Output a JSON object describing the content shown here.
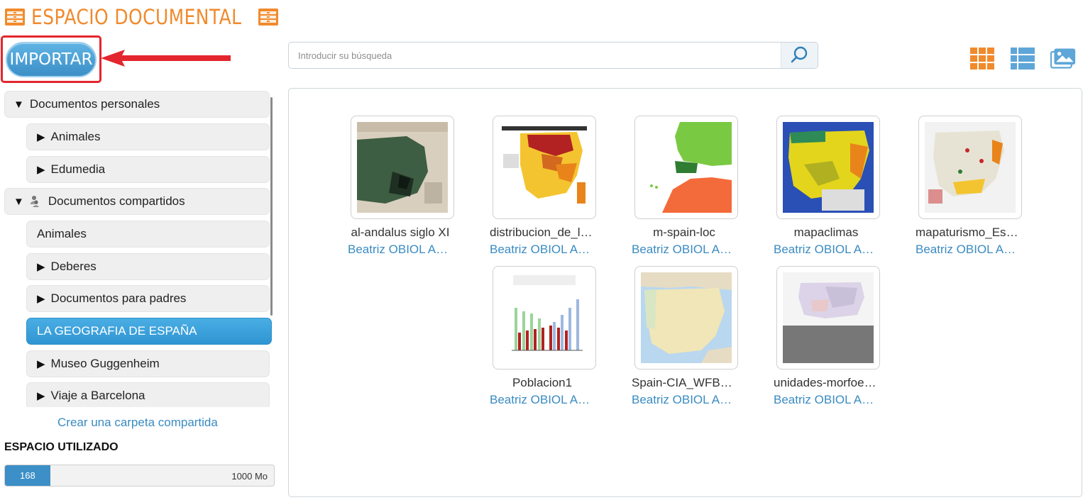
{
  "app": {
    "title": "ESPACIO DOCUMENTAL",
    "brand_color": "#f18a2c",
    "accent_color": "#3c8fc7"
  },
  "toolbar": {
    "import_label": "IMPORTAR",
    "search_placeholder": "Introducir su búsqueda",
    "search_icon": "search-icon",
    "view_icons": [
      "grid-view-icon",
      "list-view-icon",
      "gallery-view-icon"
    ]
  },
  "sidebar": {
    "personal": {
      "label": "Documentos personales",
      "expanded": true
    },
    "personal_items": [
      {
        "label": "Animales",
        "collapsed": true
      },
      {
        "label": "Edumedia",
        "collapsed": true
      }
    ],
    "shared": {
      "label": "Documentos compartidos",
      "expanded": true
    },
    "shared_items": [
      {
        "label": "Animales",
        "has_children": false
      },
      {
        "label": "Deberes",
        "has_children": true
      },
      {
        "label": "Documentos para padres",
        "has_children": true
      },
      {
        "label": "LA GEOGRAFIA DE ESPAÑA",
        "has_children": false,
        "selected": true
      },
      {
        "label": "Museo Guggenheim",
        "has_children": true
      },
      {
        "label": "Viaje a Barcelona",
        "has_children": true
      }
    ],
    "create_link": "Crear una carpeta compartida",
    "space": {
      "title": "ESPACIO UTILIZADO",
      "used": "168",
      "total": "1000 Mo",
      "used_fraction": 0.168
    }
  },
  "files": [
    {
      "name": "al-andalus siglo XI",
      "owner": "Beatriz OBIOL ALONSO",
      "thumb": "historical-map"
    },
    {
      "name": "distribucion_de_la_poblacion",
      "owner": "Beatriz OBIOL ALONSO",
      "thumb": "population-map"
    },
    {
      "name": "m-spain-loc",
      "owner": "Beatriz OBIOL ALONSO",
      "thumb": "location-map"
    },
    {
      "name": "mapaclimas",
      "owner": "Beatriz OBIOL ALONSO",
      "thumb": "climate-map"
    },
    {
      "name": "mapaturismo_España",
      "owner": "Beatriz OBIOL ALONSO",
      "thumb": "tourism-map"
    },
    {
      "name": "Poblacion1",
      "owner": "Beatriz OBIOL ALONSO",
      "thumb": "bar-chart"
    },
    {
      "name": "Spain-CIA_WFB_Map",
      "owner": "Beatriz OBIOL ALONSO",
      "thumb": "political-map"
    },
    {
      "name": "unidades-morfoestructurales",
      "owner": "Beatriz OBIOL ALONSO",
      "thumb": "relief-map"
    }
  ]
}
